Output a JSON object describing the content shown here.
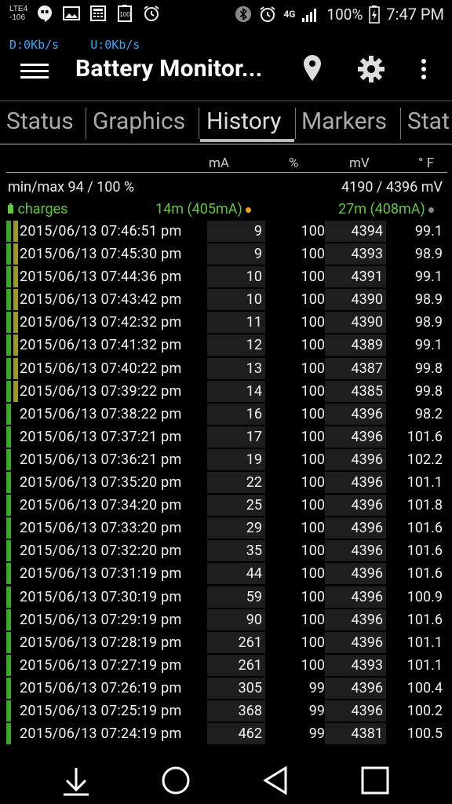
{
  "status_bar": {
    "network_type": "LTE",
    "network_sub": "4",
    "signal_dbm": "-106",
    "lte_badge": "4G",
    "battery_percent": "100%",
    "time": "7:47 PM",
    "left_icons": [
      "hangouts-icon",
      "gallery-icon",
      "calculator-icon",
      "battery-100-icon",
      "alarm-icon"
    ],
    "right_icons": [
      "bluetooth-icon",
      "alarm-icon",
      "lte-icon",
      "signal-icon",
      "battery-charging-icon"
    ]
  },
  "net_speed": {
    "down": "D:0Kb/s",
    "up": "U:0Kb/s",
    "color": "#33aaff"
  },
  "app_bar": {
    "title": "Battery Monitor...",
    "actions": [
      "location-marker-icon",
      "gear-icon",
      "overflow-menu-icon"
    ]
  },
  "tabs": [
    {
      "label": "Status",
      "active": false
    },
    {
      "label": "Graphics",
      "active": false
    },
    {
      "label": "History",
      "active": true
    },
    {
      "label": "Markers",
      "active": false
    },
    {
      "label": "Stat",
      "active": false
    }
  ],
  "table": {
    "columns": {
      "ma": "mA",
      "pct": "%",
      "mv": "mV",
      "temp": "° F"
    },
    "minmax_left": "min/max 94 / 100 %",
    "minmax_right": "4190 / 4396 mV",
    "charges_label": "charges",
    "charges_mid": "14m (405mA)",
    "charges_right": "27m (408mA)",
    "colors": {
      "green_bar": "#3aa829",
      "olive_bar": "#9a9a1e",
      "accent_green": "#5ec93a",
      "orange_dot": "#f0a020",
      "gray_dot": "#888888"
    },
    "rows": [
      {
        "date": "2015/06/13 07:46:51 pm",
        "ma": "9",
        "pct": "100",
        "mv": "4394",
        "temp": "99.1",
        "secondary": true
      },
      {
        "date": "2015/06/13 07:45:30 pm",
        "ma": "9",
        "pct": "100",
        "mv": "4393",
        "temp": "98.9",
        "secondary": true
      },
      {
        "date": "2015/06/13 07:44:36 pm",
        "ma": "10",
        "pct": "100",
        "mv": "4391",
        "temp": "99.1",
        "secondary": true
      },
      {
        "date": "2015/06/13 07:43:42 pm",
        "ma": "10",
        "pct": "100",
        "mv": "4390",
        "temp": "98.9",
        "secondary": true
      },
      {
        "date": "2015/06/13 07:42:32 pm",
        "ma": "11",
        "pct": "100",
        "mv": "4390",
        "temp": "98.9",
        "secondary": true
      },
      {
        "date": "2015/06/13 07:41:32 pm",
        "ma": "12",
        "pct": "100",
        "mv": "4389",
        "temp": "99.1",
        "secondary": true
      },
      {
        "date": "2015/06/13 07:40:22 pm",
        "ma": "13",
        "pct": "100",
        "mv": "4387",
        "temp": "99.8",
        "secondary": true
      },
      {
        "date": "2015/06/13 07:39:22 pm",
        "ma": "14",
        "pct": "100",
        "mv": "4385",
        "temp": "99.8",
        "secondary": true
      },
      {
        "date": "2015/06/13 07:38:22 pm",
        "ma": "16",
        "pct": "100",
        "mv": "4396",
        "temp": "98.2",
        "secondary": false
      },
      {
        "date": "2015/06/13 07:37:21 pm",
        "ma": "17",
        "pct": "100",
        "mv": "4396",
        "temp": "101.6",
        "secondary": false
      },
      {
        "date": "2015/06/13 07:36:21 pm",
        "ma": "19",
        "pct": "100",
        "mv": "4396",
        "temp": "102.2",
        "secondary": false
      },
      {
        "date": "2015/06/13 07:35:20 pm",
        "ma": "22",
        "pct": "100",
        "mv": "4396",
        "temp": "101.1",
        "secondary": false
      },
      {
        "date": "2015/06/13 07:34:20 pm",
        "ma": "25",
        "pct": "100",
        "mv": "4396",
        "temp": "101.8",
        "secondary": false
      },
      {
        "date": "2015/06/13 07:33:20 pm",
        "ma": "29",
        "pct": "100",
        "mv": "4396",
        "temp": "101.6",
        "secondary": false
      },
      {
        "date": "2015/06/13 07:32:20 pm",
        "ma": "35",
        "pct": "100",
        "mv": "4396",
        "temp": "101.6",
        "secondary": false
      },
      {
        "date": "2015/06/13 07:31:19 pm",
        "ma": "44",
        "pct": "100",
        "mv": "4396",
        "temp": "101.6",
        "secondary": false
      },
      {
        "date": "2015/06/13 07:30:19 pm",
        "ma": "59",
        "pct": "100",
        "mv": "4396",
        "temp": "100.9",
        "secondary": false
      },
      {
        "date": "2015/06/13 07:29:19 pm",
        "ma": "90",
        "pct": "100",
        "mv": "4396",
        "temp": "101.6",
        "secondary": false
      },
      {
        "date": "2015/06/13 07:28:19 pm",
        "ma": "261",
        "pct": "100",
        "mv": "4396",
        "temp": "101.1",
        "secondary": false
      },
      {
        "date": "2015/06/13 07:27:19 pm",
        "ma": "261",
        "pct": "100",
        "mv": "4393",
        "temp": "101.1",
        "secondary": false
      },
      {
        "date": "2015/06/13 07:26:19 pm",
        "ma": "305",
        "pct": "99",
        "mv": "4396",
        "temp": "100.4",
        "secondary": false
      },
      {
        "date": "2015/06/13 07:25:19 pm",
        "ma": "368",
        "pct": "99",
        "mv": "4396",
        "temp": "100.2",
        "secondary": false
      },
      {
        "date": "2015/06/13 07:24:19 pm",
        "ma": "462",
        "pct": "99",
        "mv": "4381",
        "temp": "100.5",
        "secondary": false
      }
    ]
  },
  "nav_bar": [
    "download-icon",
    "home-icon",
    "back-icon",
    "recents-icon"
  ]
}
